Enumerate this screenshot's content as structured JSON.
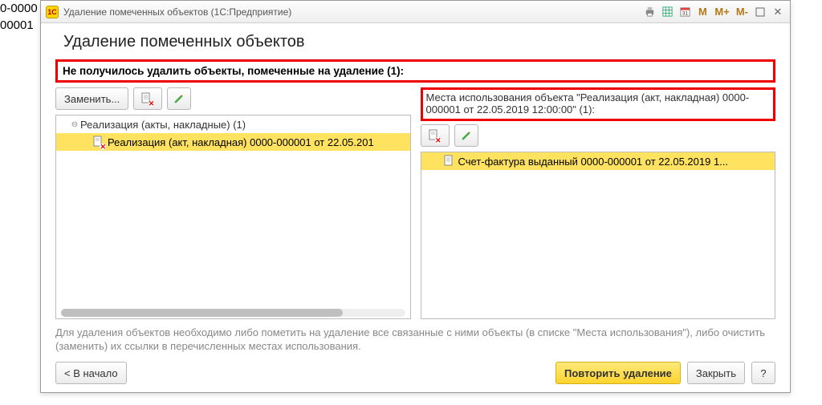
{
  "background": {
    "line1": "0-0000",
    "line2": "00001"
  },
  "window": {
    "title": "Удаление помеченных объектов  (1С:Предприятие)"
  },
  "page": {
    "heading": "Удаление помеченных объектов",
    "error_message": "Не получилось удалить объекты, помеченные на удаление (1):",
    "hint": "Для удаления объектов необходимо либо пометить на удаление все связанные с ними объекты (в списке \"Места использования\"), либо очистить (заменить) их ссылки в перечисленных местах использования."
  },
  "toolbar_left": {
    "replace": "Заменить...",
    "delete_icon": "delete-marked",
    "edit_icon": "edit"
  },
  "left_tree": {
    "group": "Реализация (акты, накладные) (1)",
    "item": "Реализация (акт, накладная) 0000-000001 от 22.05.201"
  },
  "right": {
    "label": "Места использования объекта \"Реализация (акт, накладная) 0000-000001 от 22.05.2019 12:00:00\" (1):",
    "item": "Счет-фактура выданный 0000-000001 от 22.05.2019 1..."
  },
  "footer": {
    "back": "< В начало",
    "retry": "Повторить удаление",
    "close": "Закрыть",
    "help": "?"
  }
}
